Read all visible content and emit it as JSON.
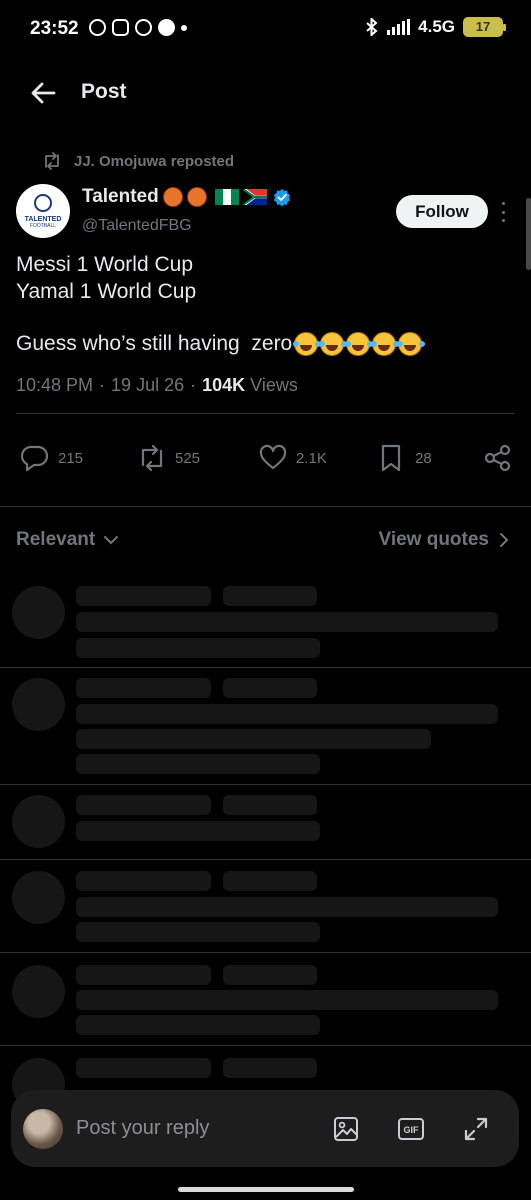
{
  "status_bar": {
    "time": "23:52",
    "network": "4.5G",
    "battery": "17",
    "app_icons": [
      "whatsapp-icon",
      "instagram-icon",
      "snapchat-icon",
      "messages-icon"
    ]
  },
  "header": {
    "title": "Post"
  },
  "repost": {
    "text": "JJ. Omojuwa reposted"
  },
  "author": {
    "name": "Talented",
    "handle": "@TalentedFBG",
    "avatar_text_1": "TALENTED",
    "avatar_text_2": "FOOTBALL",
    "name_emojis": [
      "basketball",
      "basketball",
      "flag-nigeria",
      "flag-south-africa"
    ],
    "verified": true
  },
  "follow_button": {
    "label": "Follow"
  },
  "tweet": {
    "line1": "Messi 1 World Cup",
    "line2": "Yamal 1 World Cup",
    "line3": "Guess who’s still having  zero",
    "emoji": "face-with-tears-of-joy",
    "emoji_count": 5
  },
  "meta": {
    "time": "10:48 PM",
    "date": "19 Jul 26",
    "views_count": "104K",
    "views_label": "Views"
  },
  "actions": {
    "replies": "215",
    "reposts": "525",
    "likes": "2.1K",
    "bookmarks": "28"
  },
  "replies_section": {
    "sort_label": "Relevant",
    "view_quotes_label": "View quotes"
  },
  "reply_bar": {
    "placeholder": "Post your reply"
  },
  "colors": {
    "background": "#000000",
    "text": "#e7e9ea",
    "muted": "#71767b",
    "divider": "#2f3336",
    "verified": "#1d9bf0",
    "follow_bg": "#eff3f4",
    "skeleton": "#161616",
    "reply_bar_bg": "#1d1d1d"
  }
}
